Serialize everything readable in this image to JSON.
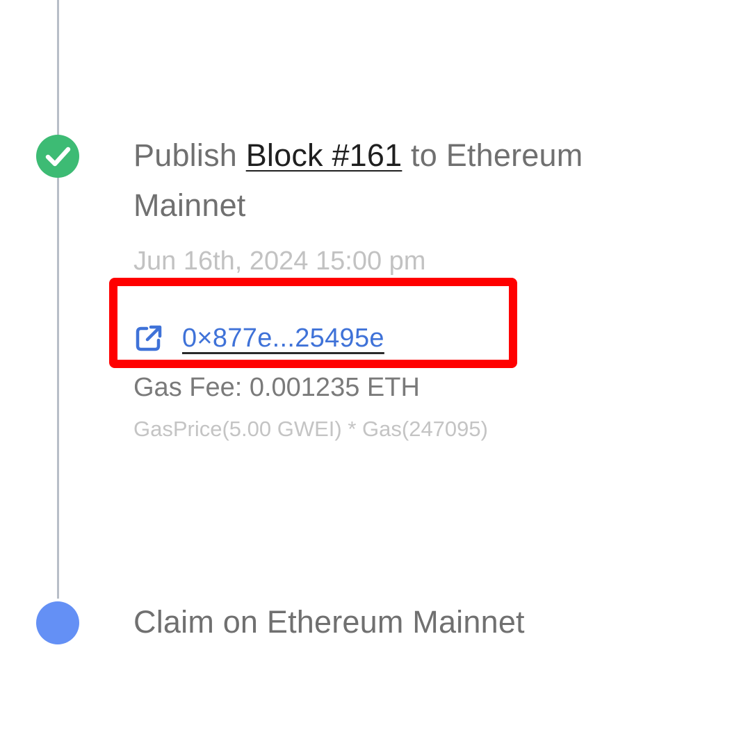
{
  "steps": [
    {
      "status": "done",
      "title_prefix": "Publish ",
      "title_link": "Block #161",
      "title_suffix": " to Ethereum Mainnet",
      "timestamp": "Jun 16th, 2024 15:00 pm",
      "tx_hash": "0×877e...25495e",
      "tx_icon": "external-link-icon",
      "gas_fee": "Gas Fee: 0.001235 ETH",
      "gas_formula": "GasPrice(5.00 GWEI) * Gas(247095)"
    },
    {
      "status": "pending",
      "title": "Claim on Ethereum Mainnet"
    }
  ],
  "colors": {
    "done": "#3dbb74",
    "pending": "#6490f5",
    "link": "#3f72d8",
    "highlight": "#ff0000",
    "timeline": "#b8bec8"
  },
  "icons": {
    "done": "check-icon",
    "tx": "external-link-icon"
  }
}
